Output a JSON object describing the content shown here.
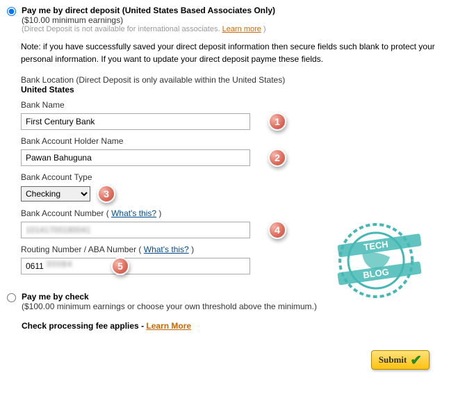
{
  "directDeposit": {
    "heading": "Pay me by direct deposit (United States Based Associates Only)",
    "subheading": "($10.00 minimum earnings)",
    "fineprint": "(Direct Deposit is not available for international associates.",
    "learnMore": "Learn more",
    "fineprintClose": " )",
    "note": "Note: if you have successfully saved your direct deposit information then secure fields such blank to protect your personal information. If you want to update your direct deposit payme these fields.",
    "bankLocationLabel": "Bank Location (Direct Deposit is only available within the United States)",
    "bankLocationValue": "United States",
    "fields": {
      "bankNameLabel": "Bank Name",
      "bankNameValue": "First Century Bank",
      "holderLabel": "Bank Account Holder Name",
      "holderValue": "Pawan Bahuguna",
      "accountTypeLabel": "Bank Account Type",
      "accountTypeValue": "Checking",
      "accountNumberLabel": "Bank Account Number ( ",
      "whatsThis": "What's this?",
      "accountNumberLabelClose": " )",
      "accountNumberValue": "10141700180041",
      "routingLabel": "Routing Number / ABA Number ( ",
      "routingLabelClose": " )",
      "routingValue": "0611",
      "routingValueBlur": "30084"
    },
    "badges": {
      "b1": "1",
      "b2": "2",
      "b3": "3",
      "b4": "4",
      "b5": "5"
    }
  },
  "checkOption": {
    "heading": "Pay me by check",
    "subheading": "($100.00 minimum earnings or choose your own threshold above the minimum.)",
    "feeText": "Check processing fee applies - ",
    "learnMore": "Learn More"
  },
  "submitLabel": "Submit",
  "watermark": {
    "top": "TECH",
    "bottom": "BLOG"
  }
}
